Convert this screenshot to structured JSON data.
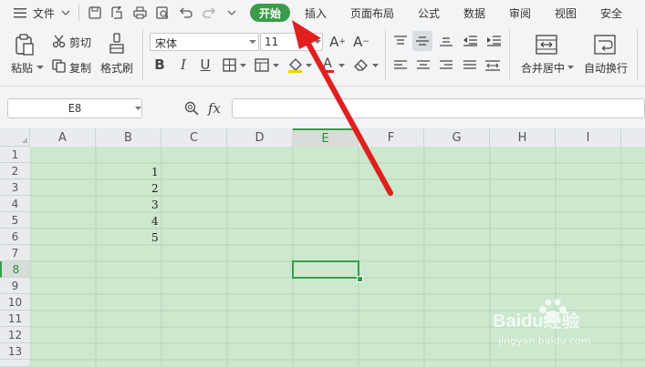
{
  "menu": {
    "file": "文件",
    "tabs": [
      "开始",
      "插入",
      "页面布局",
      "公式",
      "数据",
      "审阅",
      "视图",
      "安全"
    ]
  },
  "ribbon": {
    "paste": "粘贴",
    "cut": "剪切",
    "copy": "复制",
    "format_painter": "格式刷",
    "font_name": "宋体",
    "font_size": "11",
    "merge_center": "合并居中",
    "wrap_text": "自动换行"
  },
  "formula_bar": {
    "name_box": "E8",
    "fx": "fx",
    "content": ""
  },
  "grid": {
    "columns": [
      "A",
      "B",
      "C",
      "D",
      "E",
      "F",
      "G",
      "H",
      "I"
    ],
    "rows": [
      "1",
      "2",
      "3",
      "4",
      "5",
      "6",
      "7",
      "8",
      "9",
      "10",
      "11",
      "12",
      "13"
    ],
    "values": [
      "1",
      "2",
      "3",
      "4",
      "5"
    ],
    "active_cell": "E8"
  },
  "watermark": {
    "brand": "Baidu经验",
    "url": "jingyan.baidu.com"
  },
  "colors": {
    "accent": "#3a9b4a",
    "sheet_bg": "#cce8cf",
    "arrow": "#e0201f"
  }
}
